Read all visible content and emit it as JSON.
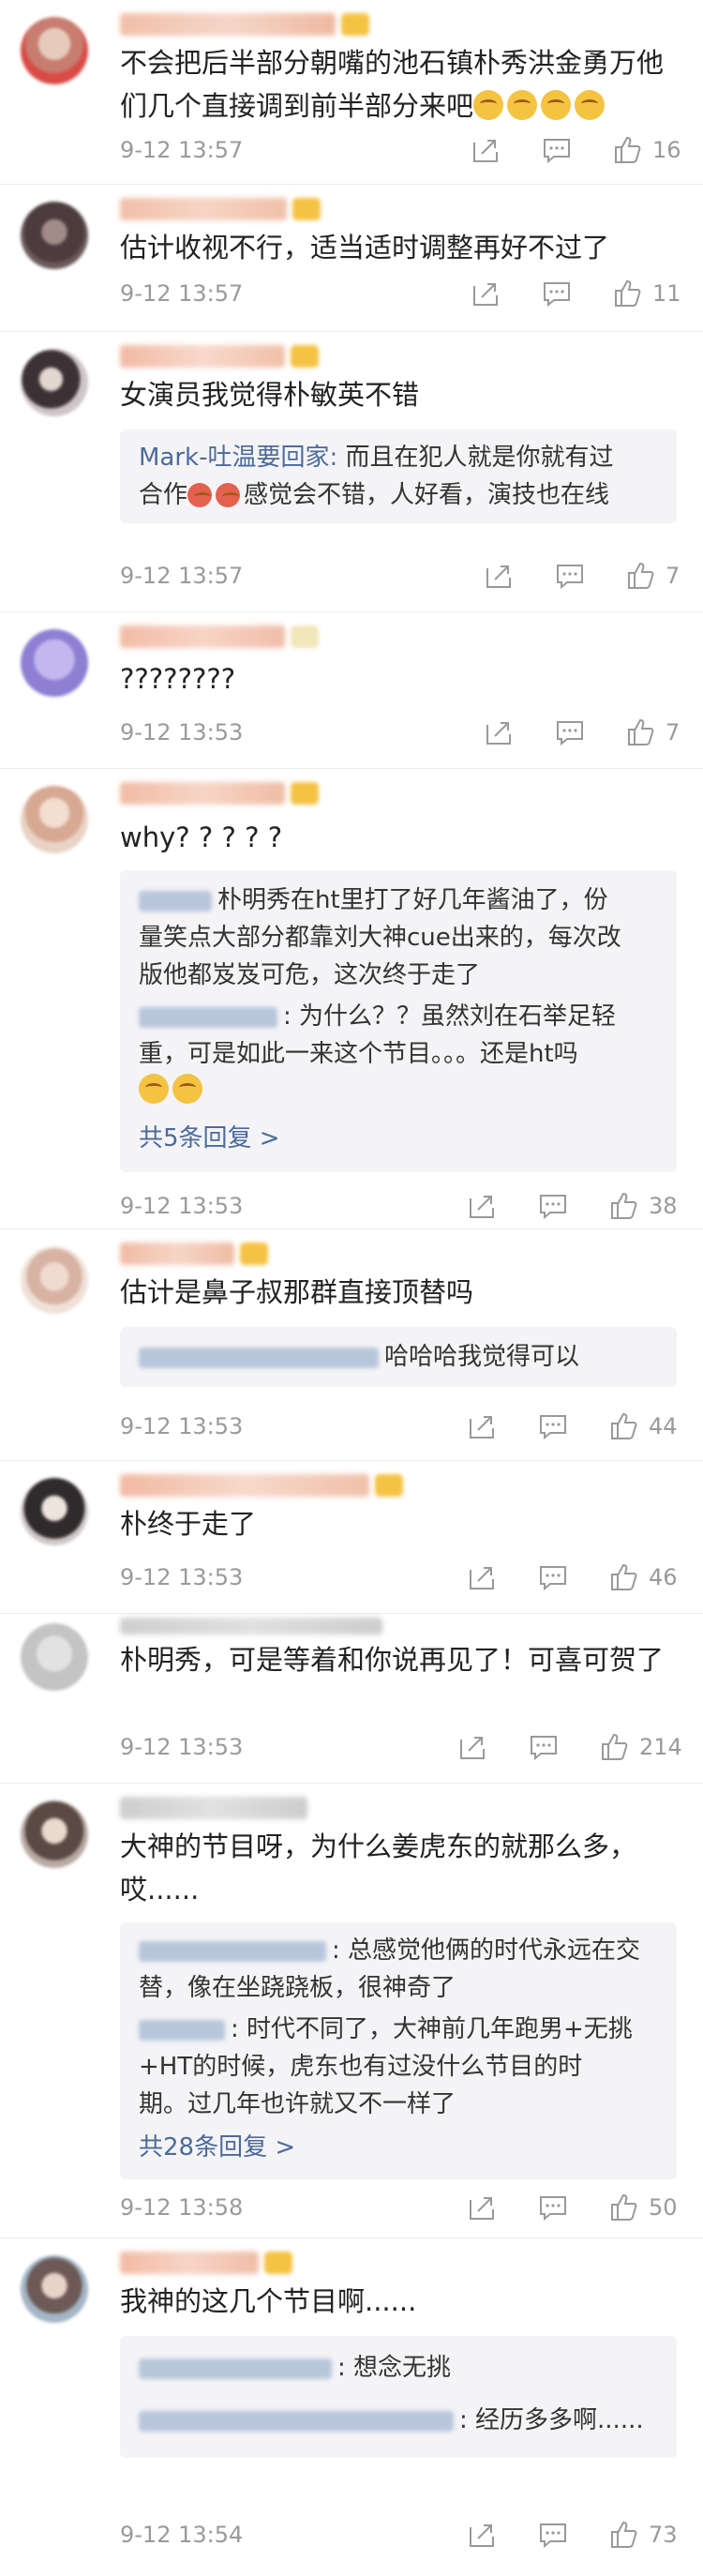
{
  "colors": {
    "link": "#4c6a9b",
    "meta": "#9a9a9a",
    "reply_bg": "#f4f4f6",
    "vip": "#f5c344"
  },
  "icons": {
    "share": "share-icon",
    "comment": "comment-icon",
    "like": "like-icon",
    "emoji": "laugh-emoji-icon"
  },
  "comments": [
    {
      "text": "不会把后半部分朝嘴的池石镇朴秀洪金勇万他们几个直接调到前半部分来吧",
      "time": "9-12 13:57",
      "likes": "16"
    },
    {
      "text": "估计收视不行，适当适时调整再好不过了",
      "time": "9-12 13:57",
      "likes": "11"
    },
    {
      "text": "女演员我觉得朴敏英不错",
      "time": "9-12 13:57",
      "likes": "7",
      "reply_name": "Mark-吐温要回家:",
      "reply_text_a": " 而且在犯人就是你就有过",
      "reply_text_b": "合作",
      "reply_text_c": "感觉会不错，人好看，演技也在线"
    },
    {
      "text": "????????",
      "time": "9-12 13:53",
      "likes": "7"
    },
    {
      "text": "why? ? ? ? ?",
      "time": "9-12 13:53",
      "likes": "38",
      "reply1_a": "朴明秀在ht里打了好几年酱油了，份",
      "reply1_b": "量笑点大部分都靠刘大神cue出来的，每次改",
      "reply1_c": "版他都岌岌可危，这次终于走了",
      "reply2_a": ": 为什么？？虽然刘在石举足轻",
      "reply2_b": "重，可是如此一来这个节目。。。还是ht吗",
      "more": "共5条回复 >"
    },
    {
      "text": "估计是鼻子叔那群直接顶替吗",
      "time": "9-12 13:53",
      "likes": "44",
      "reply1": "哈哈哈我觉得可以"
    },
    {
      "text": "朴终于走了",
      "time": "9-12 13:53",
      "likes": "46"
    },
    {
      "text": "朴明秀，可是等着和你说再见了！可喜可贺了",
      "time": "9-12 13:53",
      "likes": "214"
    },
    {
      "text": "大神的节目呀，为什么姜虎东的就那么多，哎......",
      "time": "9-12 13:58",
      "likes": "50",
      "reply1_a": ": 总感觉他俩的时代永远在交",
      "reply1_b": "替，像在坐跷跷板，很神奇了",
      "reply2_a": ": 时代不同了，大神前几年跑男+无挑",
      "reply2_b": "+HT的时候，虎东也有过没什么节目的时",
      "reply2_c": "期。过几年也许就又不一样了",
      "more": "共28条回复 >"
    },
    {
      "text": "我神的这几个节目啊......",
      "time": "9-12 13:54",
      "likes": "73",
      "reply1": ": 想念无挑",
      "reply2": ": 经历多多啊......"
    }
  ]
}
